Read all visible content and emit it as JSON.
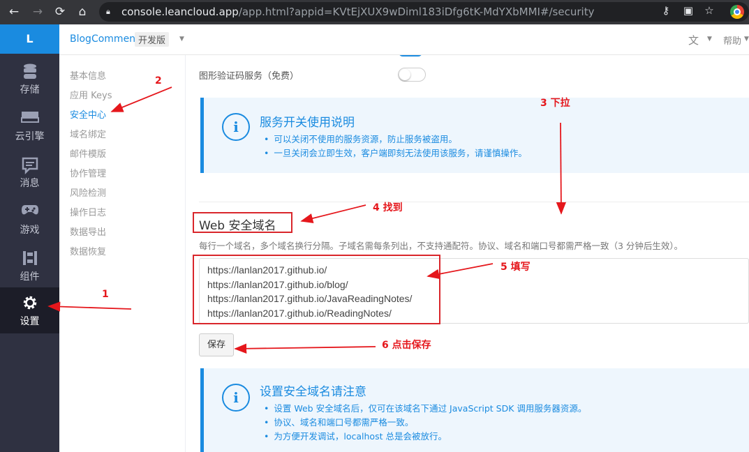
{
  "browser": {
    "url_host": "console.leancloud.app",
    "url_path": "/app.html?appid=KVtEjXUX9wDiml183iDfg6tK-MdYXbMMI#/security",
    "back_icon": "back-arrow-icon",
    "forward_icon": "forward-arrow-icon",
    "reload_icon": "reload-icon",
    "home_icon": "home-icon"
  },
  "leftnav": {
    "logo": "L",
    "items": [
      {
        "label": "存储",
        "icon": "database-icon"
      },
      {
        "label": "云引擎",
        "icon": "cloud-engine-icon"
      },
      {
        "label": "消息",
        "icon": "message-icon"
      },
      {
        "label": "游戏",
        "icon": "gamepad-icon"
      },
      {
        "label": "组件",
        "icon": "components-icon"
      },
      {
        "label": "设置",
        "icon": "gear-icon"
      }
    ]
  },
  "header": {
    "app_name": "BlogComment",
    "env": "开发版",
    "help": "帮助"
  },
  "subnav": {
    "items": [
      "基本信息",
      "应用 Keys",
      "安全中心",
      "域名绑定",
      "邮件模版",
      "协作管理",
      "风险检测",
      "操作日志",
      "数据导出",
      "数据恢复"
    ],
    "active": "安全中心"
  },
  "main": {
    "captcha_label": "图形验证码服务（免费）",
    "captcha_enabled": false,
    "info1": {
      "title": "服务开关使用说明",
      "items": [
        "可以关闭不使用的服务资源，防止服务被盗用。",
        "一旦关闭会立即生效，客户端即刻无法使用该服务，请谨慎操作。"
      ]
    },
    "web_title": "Web 安全域名",
    "web_desc": "每行一个域名，多个域名换行分隔。子域名需每条列出，不支持通配符。协议、域名和端口号都需严格一致（3 分钟后生效）。",
    "domains": "https://lanlan2017.github.io/\nhttps://lanlan2017.github.io/blog/\nhttps://lanlan2017.github.io/JavaReadingNotes/\nhttps://lanlan2017.github.io/ReadingNotes/",
    "save": "保存",
    "info2": {
      "title": "设置安全域名请注意",
      "items": [
        "设置 Web 安全域名后，仅可在该域名下通过 JavaScript SDK 调用服务器资源。",
        "协议、域名和端口号都需严格一致。",
        "为方便开发调试，localhost 总是会被放行。"
      ]
    }
  },
  "annotations": {
    "a1": "1",
    "a2": "2",
    "a3": "3 下拉",
    "a4": "4 找到",
    "a5": "5 填写",
    "a6": "6 点击保存",
    "color": "#e5171c"
  }
}
